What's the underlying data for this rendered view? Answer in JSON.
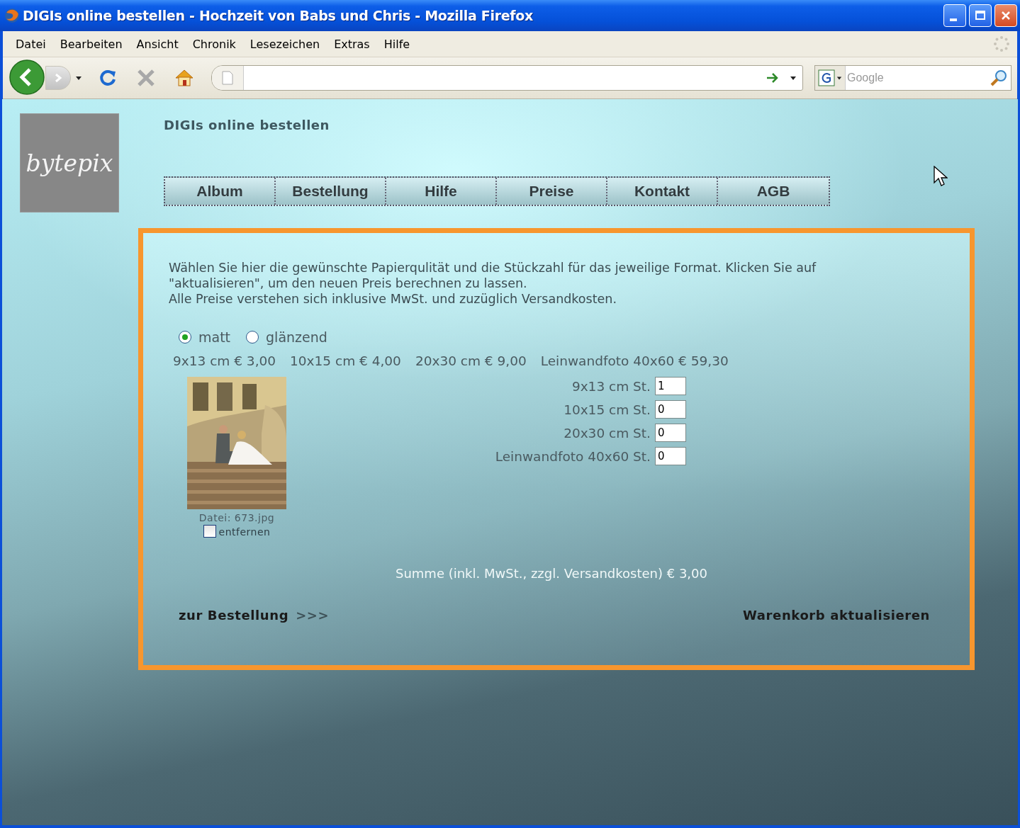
{
  "window": {
    "title": "DIGIs online bestellen - Hochzeit von Babs und Chris - Mozilla Firefox"
  },
  "menu": [
    "Datei",
    "Bearbeiten",
    "Ansicht",
    "Chronik",
    "Lesezeichen",
    "Extras",
    "Hilfe"
  ],
  "toolbar": {
    "search": {
      "placeholder": "Google"
    }
  },
  "page": {
    "logo": "bytepix",
    "heading": "DIGIs online bestellen",
    "nav": [
      "Album",
      "Bestellung",
      "Hilfe",
      "Preise",
      "Kontakt",
      "AGB"
    ],
    "intro": [
      "Wählen Sie hier die gewünschte Papierqulität und die Stückzahl für das jeweilige Format. Klicken Sie auf \"aktualisieren\", um den neuen Preis berechnen zu lassen.",
      "Alle Preise verstehen sich inklusive MwSt. und zuzüglich Versandkosten."
    ],
    "paper": [
      {
        "label": "matt",
        "selected": true
      },
      {
        "label": "glänzend",
        "selected": false
      }
    ],
    "prices": [
      "9x13 cm € 3,00",
      "10x15 cm € 4,00",
      "20x30 cm € 9,00",
      "Leinwandfoto 40x60 € 59,30"
    ],
    "photo": {
      "kind": "picture",
      "caption": "Datei: 673.jpg",
      "remove": {
        "label": "entfernen",
        "checked": false
      }
    },
    "quantities": [
      {
        "label": "9x13 cm St.",
        "value": "1"
      },
      {
        "label": "10x15 cm St.",
        "value": "0"
      },
      {
        "label": "20x30 cm St.",
        "value": "0"
      },
      {
        "label": "Leinwandfoto 40x60 St.",
        "value": "0"
      }
    ],
    "sum": "Summe (inkl. MwSt., zzgl. Versandkosten) € 3,00",
    "order_link": {
      "label": "zur Bestellung",
      "arrows": ">>>"
    },
    "update_link": "Warenkorb aktualisieren"
  }
}
